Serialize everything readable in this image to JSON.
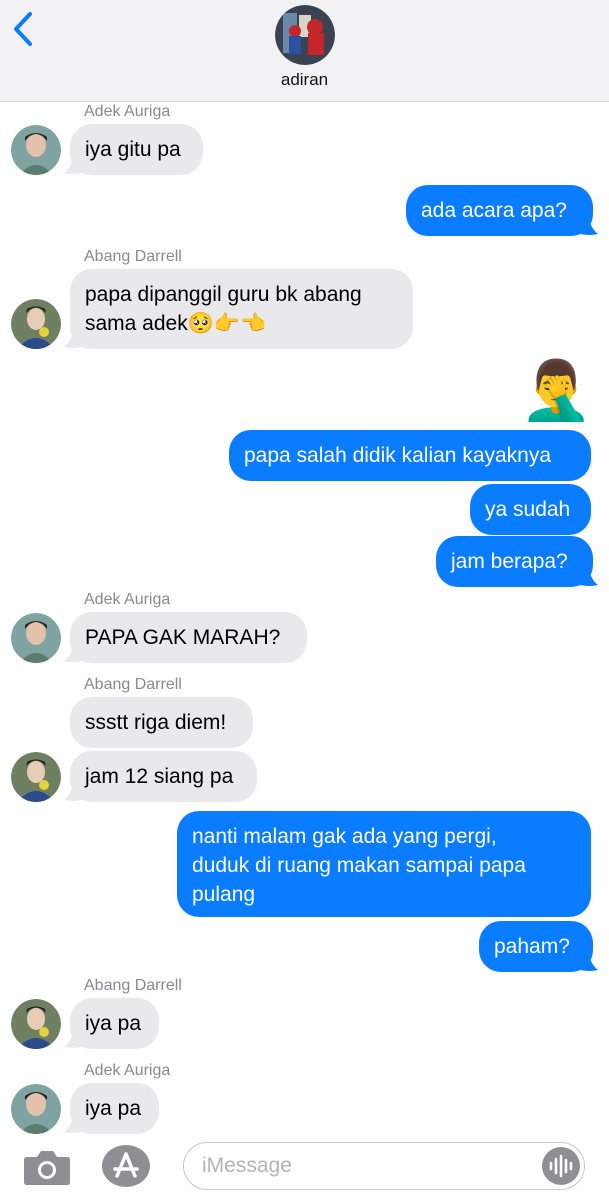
{
  "header": {
    "contact_name": "adiran"
  },
  "messages": [
    {
      "sender": "Adek Auriga",
      "text": "iya gitu pa"
    },
    {
      "text": "ada acara apa?"
    },
    {
      "sender": "Abang Darrell",
      "text": "papa dipanggil guru bk abang\nsama adek🥺👉👈"
    },
    {
      "emoji": "🤦‍♂️"
    },
    {
      "text": "papa salah didik kalian kayaknya"
    },
    {
      "text": "ya sudah"
    },
    {
      "text": "jam berapa?"
    },
    {
      "sender": "Adek Auriga",
      "text": "PAPA GAK MARAH?"
    },
    {
      "sender": "Abang Darrell",
      "text": "ssstt riga diem!"
    },
    {
      "text": "jam 12 siang pa"
    },
    {
      "text": "nanti malam gak ada yang pergi,\nduduk di ruang makan sampai papa\npulang"
    },
    {
      "text": "paham?"
    },
    {
      "sender": "Abang Darrell",
      "text": "iya pa"
    },
    {
      "sender": "Adek Auriga",
      "text": "iya pa"
    }
  ],
  "input": {
    "placeholder": "iMessage"
  },
  "colors": {
    "outgoing": "#0a7cff",
    "incoming": "#e9e9eb",
    "sender_label": "#8a8a8e"
  }
}
